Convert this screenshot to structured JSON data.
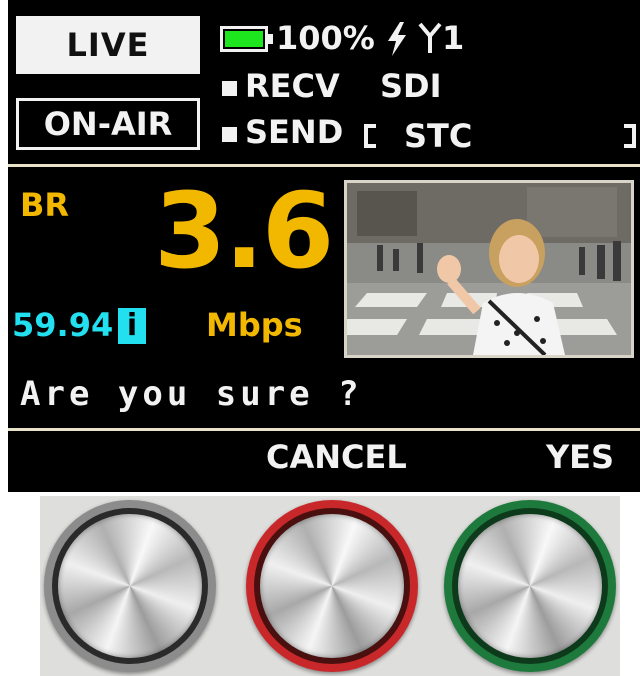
{
  "status": {
    "live_label": "LIVE",
    "onair_label": "ON-AIR",
    "battery_percent": "100%",
    "battery_level": 1.0,
    "signal_label": "1",
    "recv_label": "RECV",
    "sdi_label": "SDI",
    "send_label": "SEND",
    "stc_label": "STC"
  },
  "bitrate": {
    "label": "BR",
    "value": "3.6",
    "unit": "Mbps",
    "framerate": "59.94",
    "scan_badge": "i"
  },
  "dialog": {
    "prompt": "Are you sure ?",
    "cancel_label": "CANCEL",
    "yes_label": "YES"
  },
  "colors": {
    "accent_yellow": "#f2b800",
    "accent_cyan": "#22e0f0",
    "battery_green": "#1ee61e",
    "knob_gray_ring": "#8c8c8c",
    "knob_red_ring": "#c8282a",
    "knob_green_ring": "#1e7a3c"
  },
  "icons": {
    "battery": "battery-icon",
    "bolt": "lightning-icon",
    "signal": "antenna-icon",
    "preview": "video-preview-thumbnail"
  }
}
